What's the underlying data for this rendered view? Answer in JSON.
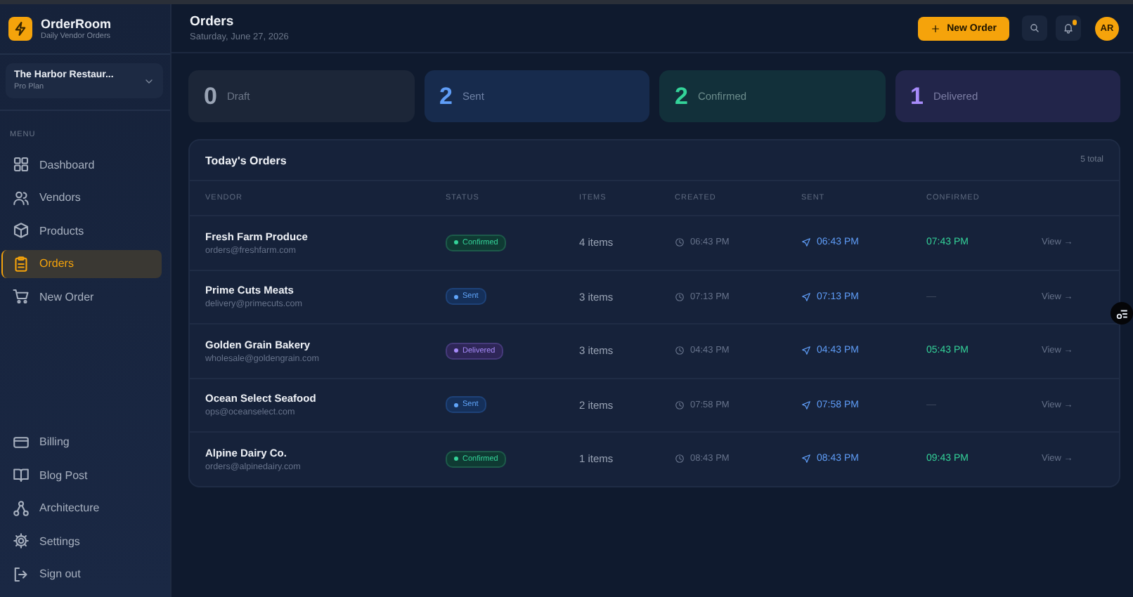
{
  "brand": {
    "name": "OrderRoom",
    "tagline": "Daily Vendor Orders"
  },
  "account": {
    "name": "The Harbor Restaur...",
    "plan": "Pro Plan"
  },
  "sidebar": {
    "menu_label": "MENU",
    "items": [
      {
        "label": "Dashboard",
        "selected": false
      },
      {
        "label": "Vendors",
        "selected": false
      },
      {
        "label": "Products",
        "selected": false
      },
      {
        "label": "Orders",
        "selected": true
      },
      {
        "label": "New Order",
        "selected": false
      }
    ],
    "footer_items": [
      {
        "label": "Billing"
      },
      {
        "label": "Blog Post"
      },
      {
        "label": "Architecture"
      },
      {
        "label": "Settings"
      },
      {
        "label": "Sign out"
      }
    ]
  },
  "header": {
    "title": "Orders",
    "date": "Saturday, June 27, 2026",
    "new_order_button": "New Order",
    "avatar": "AR",
    "notification_unread": true
  },
  "stats": [
    {
      "kind": "draft",
      "count": "0",
      "label": "Draft"
    },
    {
      "kind": "sent",
      "count": "2",
      "label": "Sent"
    },
    {
      "kind": "confirmed",
      "count": "2",
      "label": "Confirmed"
    },
    {
      "kind": "delivered",
      "count": "1",
      "label": "Delivered"
    }
  ],
  "table": {
    "title": "Today's Orders",
    "total": "5 total",
    "columns": [
      "VENDOR",
      "STATUS",
      "ITEMS",
      "CREATED",
      "SENT",
      "CONFIRMED"
    ],
    "rows": [
      {
        "vendor": "Fresh Farm Produce",
        "email": "orders@freshfarm.com",
        "status": {
          "kind": "confirmed",
          "label": "Confirmed"
        },
        "items": "4 items",
        "created": "06:43 PM",
        "sent": "06:43 PM",
        "confirmed": "07:43 PM",
        "action": "View →"
      },
      {
        "vendor": "Prime Cuts Meats",
        "email": "delivery@primecuts.com",
        "status": {
          "kind": "sent",
          "label": "Sent"
        },
        "items": "3 items",
        "created": "07:13 PM",
        "sent": "07:13 PM",
        "confirmed": "—",
        "action": "View →"
      },
      {
        "vendor": "Golden Grain Bakery",
        "email": "wholesale@goldengrain.com",
        "status": {
          "kind": "delivered",
          "label": "Delivered"
        },
        "items": "3 items",
        "created": "04:43 PM",
        "sent": "04:43 PM",
        "confirmed": "05:43 PM",
        "action": "View →"
      },
      {
        "vendor": "Ocean Select Seafood",
        "email": "ops@oceanselect.com",
        "status": {
          "kind": "sent",
          "label": "Sent"
        },
        "items": "2 items",
        "created": "07:58 PM",
        "sent": "07:58 PM",
        "confirmed": "—",
        "action": "View →"
      },
      {
        "vendor": "Alpine Dairy Co.",
        "email": "orders@alpinedairy.com",
        "status": {
          "kind": "confirmed",
          "label": "Confirmed"
        },
        "items": "1 items",
        "created": "08:43 PM",
        "sent": "08:43 PM",
        "confirmed": "09:43 PM",
        "action": "View →"
      }
    ]
  }
}
